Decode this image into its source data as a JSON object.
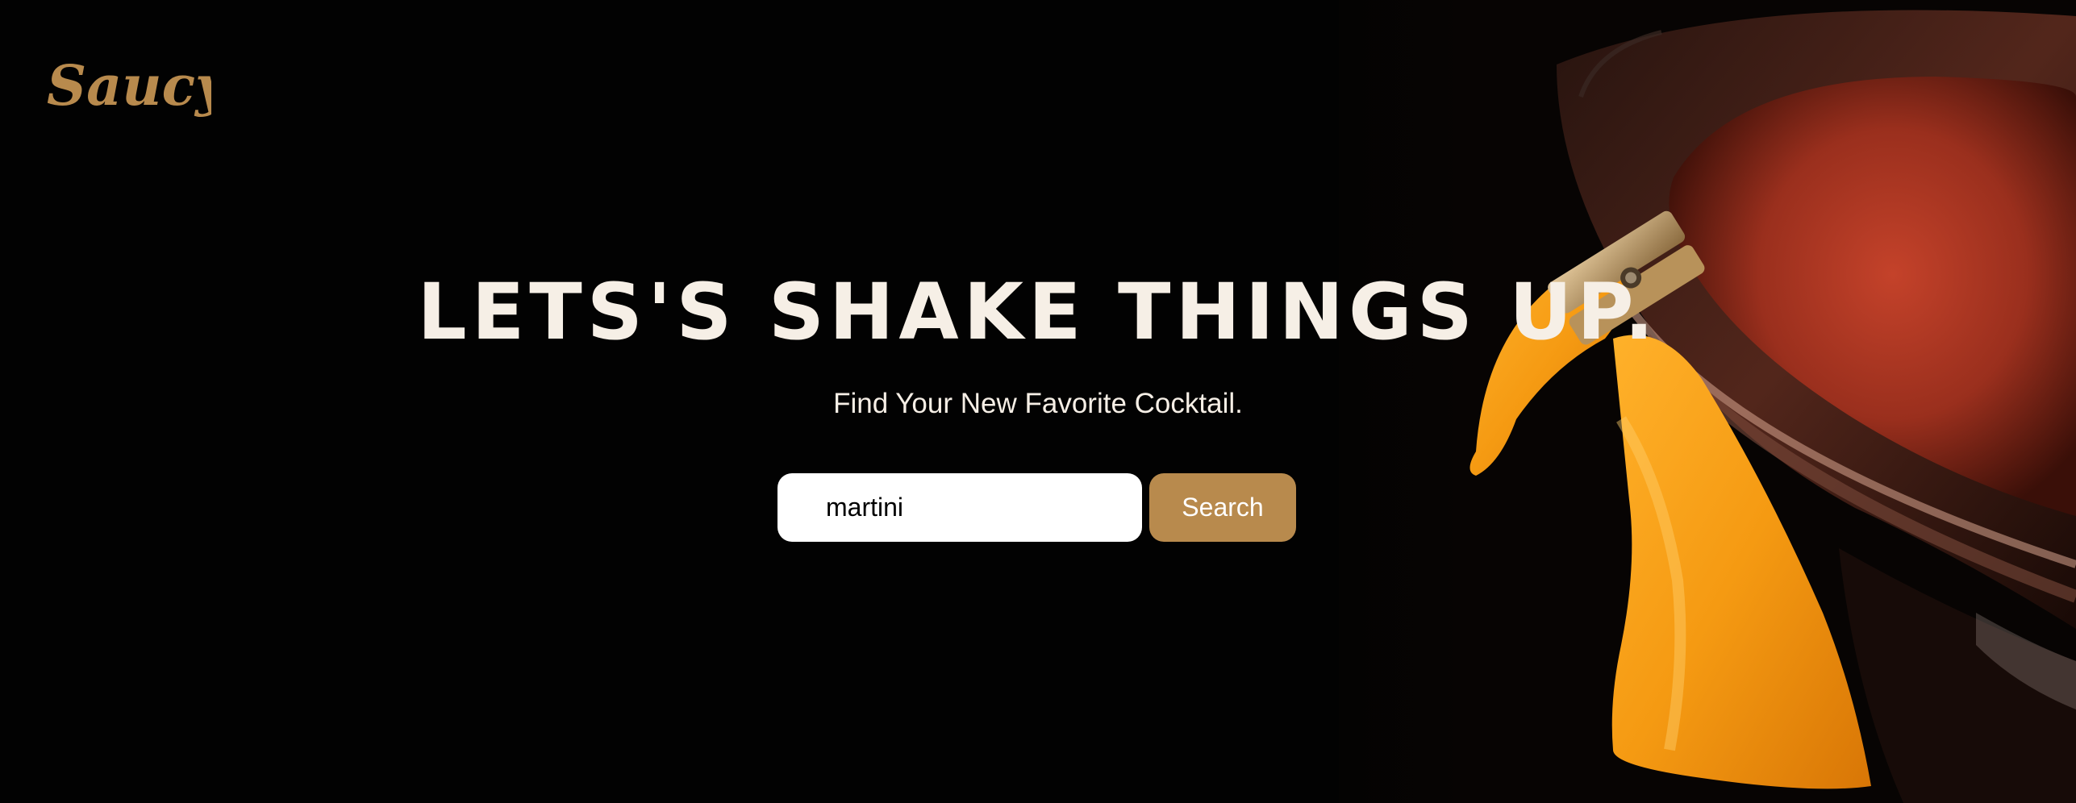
{
  "brand": {
    "name": "Saucy",
    "color": "#b88a4d"
  },
  "hero": {
    "headline": "LETS'S SHAKE THINGS UP.",
    "subtitle": "Find Your New Favorite Cocktail.",
    "image_icon": "cocktail-glass-with-orange-peel-photo"
  },
  "search": {
    "value": "martini",
    "button_label": "Search",
    "button_color": "#b88a4d"
  }
}
